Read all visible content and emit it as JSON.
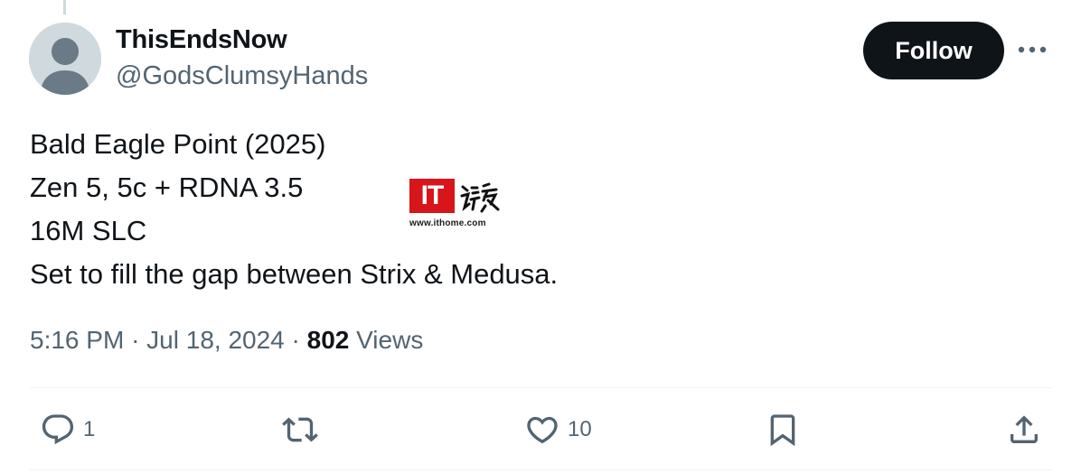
{
  "author": {
    "display_name": "ThisEndsNow",
    "handle": "@GodsClumsyHands",
    "avatar_icon": "default-avatar-icon"
  },
  "follow_button": {
    "label": "Follow"
  },
  "more_button": {
    "icon": "more-horizontal-icon"
  },
  "tweet": {
    "lines": [
      "Bald Eagle Point (2025)",
      "Zen 5, 5c + RDNA 3.5",
      "16M SLC",
      "Set to fill the gap between Strix & Medusa."
    ]
  },
  "meta": {
    "time": "5:16 PM",
    "separator": "·",
    "date": "Jul 18, 2024",
    "views_count": "802",
    "views_label": "Views"
  },
  "actions": {
    "reply": {
      "icon": "reply-icon",
      "count": "1"
    },
    "repost": {
      "icon": "repost-icon",
      "count": ""
    },
    "like": {
      "icon": "heart-icon",
      "count": "10"
    },
    "bookmark": {
      "icon": "bookmark-icon",
      "count": ""
    },
    "share": {
      "icon": "share-icon",
      "count": ""
    }
  },
  "watermark": {
    "logo_text": "IT",
    "url": "www.ithome.com"
  },
  "colors": {
    "text_primary": "#0f1419",
    "text_secondary": "#536471",
    "follow_bg": "#0f1419",
    "divider": "#eff3f4",
    "watermark_red": "#d7151b"
  }
}
